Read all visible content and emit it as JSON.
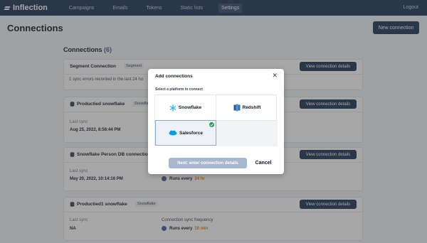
{
  "app": {
    "logo_text": "Inflection"
  },
  "nav": {
    "items": [
      {
        "label": "Campaigns"
      },
      {
        "label": "Emails"
      },
      {
        "label": "Tokens"
      },
      {
        "label": "Static lists"
      },
      {
        "label": "Settings"
      }
    ],
    "active": "Settings",
    "logout_label": "Logout"
  },
  "page": {
    "title": "Connections",
    "new_button": "New connection",
    "section_title": "Connections",
    "section_count": "(6)"
  },
  "connections": [
    {
      "name": "Segment Connection",
      "badge": "Segment",
      "view_label": "View connection details",
      "error_text": "1 sync errors recorded in the last 24 ho"
    },
    {
      "name": "Productied snowflake",
      "badge": "Snowfla",
      "view_label": "View connection details",
      "last_sync_label": "Last sync",
      "last_sync_value": "Aug 25, 2022, 8:56:44 PM"
    },
    {
      "name": "Snowflake Person DB connection",
      "view_label": "View connection details",
      "last_sync_label": "Last sync",
      "last_sync_value": "May 20, 2022, 10:14:16 PM",
      "runs_label": "Runs every",
      "runs_value": "24 hr"
    },
    {
      "name": "Productied1 snowflake",
      "badge": "Snowflake",
      "view_label": "View connection details",
      "last_sync_label": "Last sync",
      "last_sync_value": "NA",
      "freq_label": "Connection sync frequency",
      "runs_label": "Runs every",
      "runs_value": "10 min"
    }
  ],
  "modal": {
    "title": "Add connections",
    "subtitle": "Select a platform to connect",
    "platforms": [
      {
        "label": "Snowflake",
        "icon": "snowflake-icon"
      },
      {
        "label": "Redshift",
        "icon": "redshift-icon"
      },
      {
        "label": "Salesforce",
        "icon": "salesforce-icon",
        "selected": true
      }
    ],
    "next_label": "Next: enter connection details",
    "cancel_label": "Cancel"
  },
  "colors": {
    "nav_bg": "#1d3256",
    "accent": "#3b5f98",
    "orange": "#d97706",
    "check": "#16a34a"
  }
}
